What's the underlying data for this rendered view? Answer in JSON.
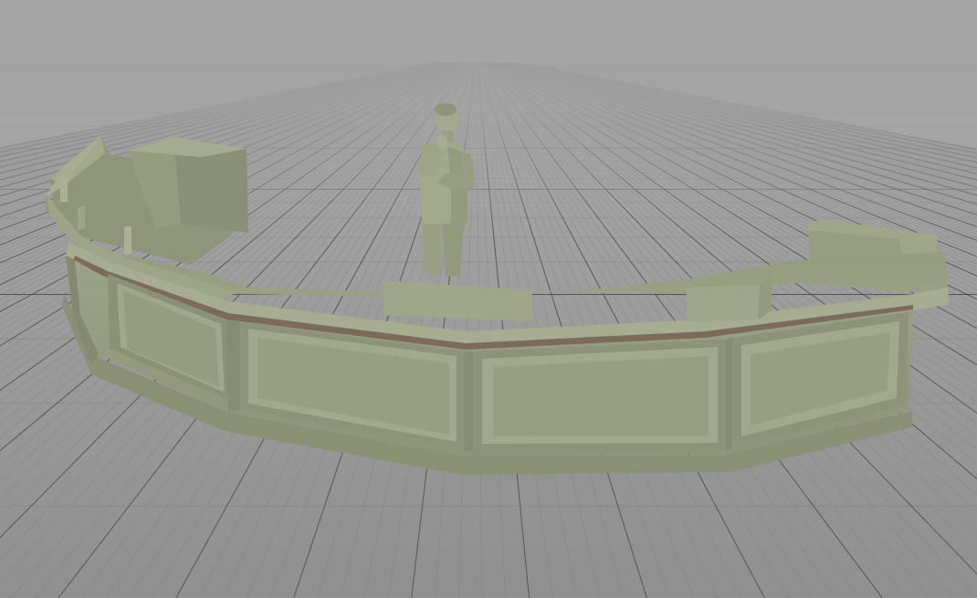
{
  "viewport": {
    "background_top": "#a8a8a8",
    "background_horizon": "#9c9c9c",
    "grid_major_color": "#4a4a4a",
    "grid_minor_color": "#7d7d7d",
    "model_color": "#98a080",
    "model_shadow": "#7a8068",
    "model_highlight": "#aab08f",
    "inlay_color": "#7a6a58"
  },
  "scene": {
    "objects": [
      {
        "name": "reception-desk",
        "kind": "curved reception counter"
      },
      {
        "name": "human-figure",
        "kind": "scale reference figure"
      },
      {
        "name": "ground-grid",
        "kind": "infinite ground plane grid"
      }
    ]
  }
}
